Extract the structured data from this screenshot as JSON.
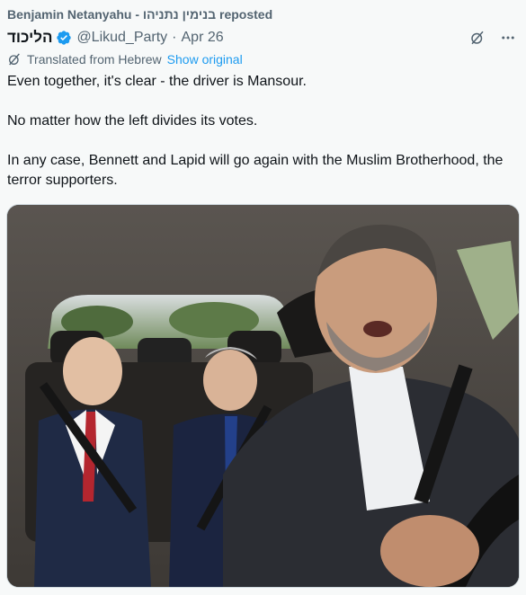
{
  "repost": {
    "text": "Benjamin Netanyahu - בנימין נתניהו reposted"
  },
  "post": {
    "author_name": "הליכוד",
    "handle": "@Likud_Party",
    "separator": "·",
    "date": "Apr 26",
    "translated_label": "Translated from Hebrew",
    "show_original": "Show original",
    "paragraphs": [
      "Even together, it's clear - the driver is Mansour.",
      "No matter how the left divides its votes.",
      "In any case, Bennett and Lapid will go again with the Muslim Brotherhood, the terror supporters."
    ]
  },
  "icons": {
    "verified": "verified-badge-icon",
    "grok": "grok-icon",
    "more": "more-icon",
    "translate": "translate-icon"
  },
  "colors": {
    "accent": "#1d9bf0",
    "muted": "#536471",
    "text": "#0f1419",
    "background": "#f7f9f9"
  }
}
